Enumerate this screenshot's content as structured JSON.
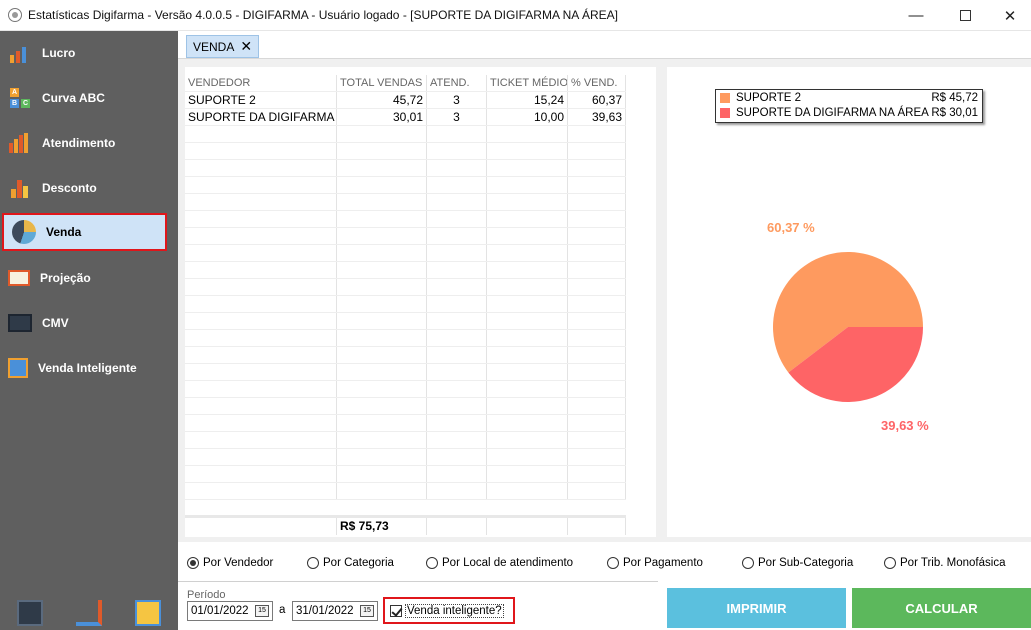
{
  "window": {
    "title": "Estatísticas Digifarma - Versão 4.0.0.5 - DIGIFARMA -  Usuário logado - [SUPORTE DA DIGIFARMA NA ÁREA]"
  },
  "sidebar": {
    "items": [
      {
        "label": "Lucro",
        "icon": "growth-chart-icon"
      },
      {
        "label": "Curva ABC",
        "icon": "abc-blocks-icon"
      },
      {
        "label": "Atendimento",
        "icon": "bar-chart-icon"
      },
      {
        "label": "Desconto",
        "icon": "column-chart-icon"
      },
      {
        "label": "Venda",
        "icon": "pie-chart-icon",
        "active": true
      },
      {
        "label": "Projeção",
        "icon": "presentation-board-icon"
      },
      {
        "label": "CMV",
        "icon": "monitor-chart-icon"
      },
      {
        "label": "Venda Inteligente",
        "icon": "smart-sales-icon"
      }
    ],
    "bottom_icons": [
      "dashboard-icon",
      "trend-hand-icon",
      "report-icon"
    ]
  },
  "tabs": [
    {
      "label": "VENDA",
      "close": "✕"
    }
  ],
  "grid": {
    "columns": [
      "VENDEDOR",
      "TOTAL VENDAS",
      "ATEND.",
      "TICKET MÉDIO",
      "% VEND."
    ],
    "rows": [
      [
        "SUPORTE 2",
        "45,72",
        "3",
        "15,24",
        "60,37"
      ],
      [
        "SUPORTE DA DIGIFARMA N...",
        "30,01",
        "3",
        "10,00",
        "39,63"
      ]
    ],
    "total": "R$ 75,73"
  },
  "chart_data": {
    "type": "pie",
    "categories": [
      "SUPORTE 2",
      "SUPORTE DA DIGIFARMA NA ÁREA"
    ],
    "values": [
      45.72,
      30.01
    ],
    "value_labels": [
      "R$ 45,72",
      "R$ 30,01"
    ],
    "percent_labels": [
      "60,37 %",
      "39,63 %"
    ],
    "colors": [
      "#fe9a5f",
      "#fe6466"
    ],
    "legend_position": "top"
  },
  "bottom": {
    "radios": [
      {
        "label": "Por Vendedor",
        "checked": true
      },
      {
        "label": "Por Categoria",
        "checked": false
      },
      {
        "label": "Por Local de atendimento",
        "checked": false
      },
      {
        "label": "Por Pagamento",
        "checked": false
      },
      {
        "label": "Por Sub-Categoria",
        "checked": false
      },
      {
        "label": "Por Trib. Monofásica",
        "checked": false
      }
    ],
    "period_label": "Período",
    "date_from": "01/01/2022",
    "date_to": "31/01/2022",
    "date_sep": "a",
    "calendar_glyph": "15",
    "smart_sale_label": "Venda inteligente?",
    "smart_sale_checked": true,
    "print_label": "IMPRIMIR",
    "calc_label": "CALCULAR"
  }
}
